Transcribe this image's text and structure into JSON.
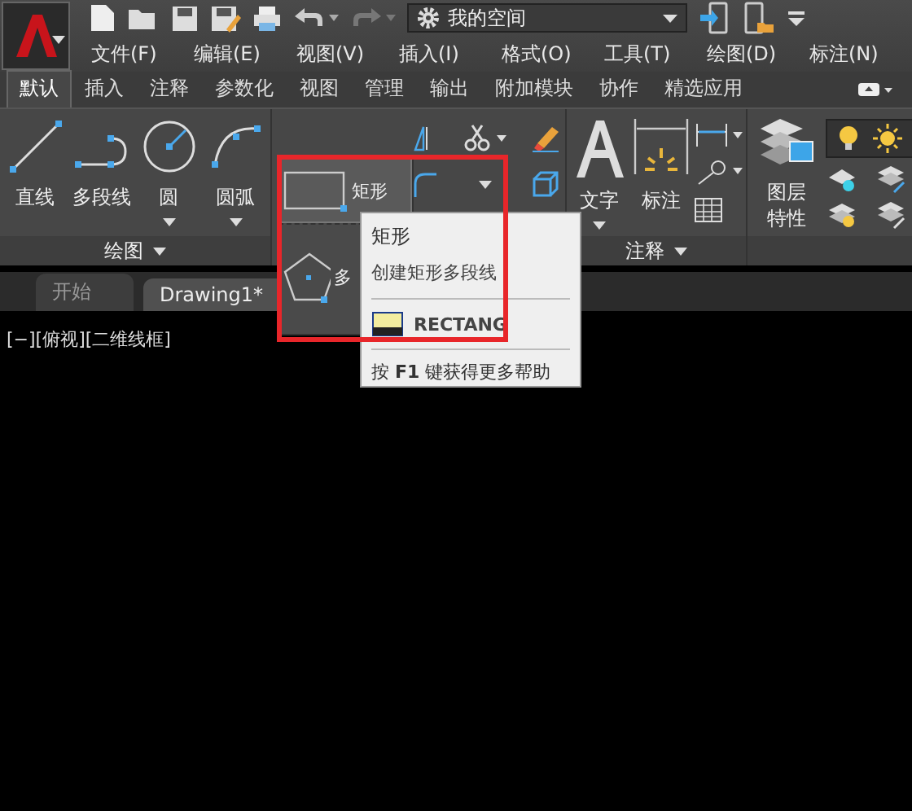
{
  "quick_access": {
    "workspace": "我的空间"
  },
  "menu": [
    "文件(F)",
    "编辑(E)",
    "视图(V)",
    "插入(I)",
    "格式(O)",
    "工具(T)",
    "绘图(D)",
    "标注(N)"
  ],
  "ribbon_tabs": [
    {
      "label": "默认",
      "selected": true
    },
    {
      "label": "插入",
      "selected": false
    },
    {
      "label": "注释",
      "selected": false
    },
    {
      "label": "参数化",
      "selected": false
    },
    {
      "label": "视图",
      "selected": false
    },
    {
      "label": "管理",
      "selected": false
    },
    {
      "label": "输出",
      "selected": false
    },
    {
      "label": "附加模块",
      "selected": false
    },
    {
      "label": "协作",
      "selected": false
    },
    {
      "label": "精选应用",
      "selected": false
    }
  ],
  "draw_panel": {
    "title": "绘图",
    "tools": [
      {
        "label": "直线",
        "kind": "line",
        "dropdown": false
      },
      {
        "label": "多段线",
        "kind": "polyline",
        "dropdown": false
      },
      {
        "label": "圆",
        "kind": "circle",
        "dropdown": true
      },
      {
        "label": "圆弧",
        "kind": "arc",
        "dropdown": true
      }
    ]
  },
  "annotation_panel": {
    "title": "注释",
    "tools": [
      {
        "label": "文字",
        "kind": "text",
        "dropdown": true
      },
      {
        "label": "标注",
        "kind": "dimension",
        "dropdown": false
      }
    ]
  },
  "layers_panel": {
    "tools": [
      {
        "label": "图层特性",
        "kind": "layers"
      }
    ]
  },
  "file_tabs": [
    {
      "label": "开始",
      "selected": false
    },
    {
      "label": "Drawing1*",
      "selected": true
    }
  ],
  "viewport_label": "[−][俯视][二维线框]",
  "flyout": [
    {
      "label": "矩形",
      "kind": "rectangle",
      "selected": true
    },
    {
      "label": "多",
      "kind": "polygon",
      "selected": false
    }
  ],
  "tooltip": {
    "title": "矩形",
    "description": "创建矩形多段线",
    "command": "RECTANG",
    "help": "按 **F1** 键获得更多帮助"
  }
}
